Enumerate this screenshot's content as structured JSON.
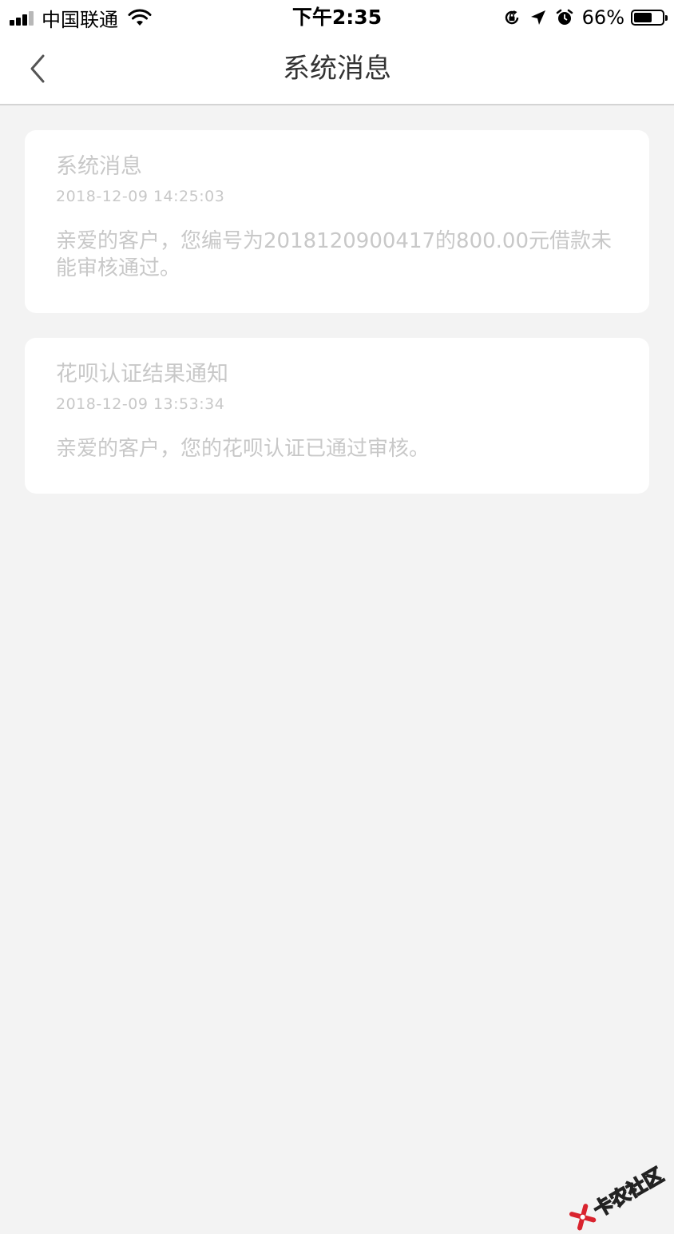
{
  "status_bar": {
    "carrier": "中国联通",
    "time": "下午2:35",
    "battery_percent": "66%",
    "battery_level": 0.66,
    "signal_bars": 3,
    "icons": [
      "signal-icon",
      "wifi-icon",
      "orientation-lock-icon",
      "location-arrow-icon",
      "alarm-icon",
      "battery-icon"
    ]
  },
  "nav": {
    "title": "系统消息",
    "back_icon": "chevron-left-icon"
  },
  "messages": [
    {
      "title": "系统消息",
      "time": "2018-12-09 14:25:03",
      "body": "亲爱的客户，您编号为2018120900417的800.00元借款未能审核通过。"
    },
    {
      "title": "花呗认证结果通知",
      "time": "2018-12-09 13:53:34",
      "body": "亲爱的客户，您的花呗认证已通过审核。"
    }
  ],
  "watermark": {
    "text": "卡农社区"
  },
  "colors": {
    "background": "#f3f3f3",
    "card": "#ffffff",
    "muted_text": "#c8c8c8",
    "title_text": "#333333",
    "watermark_red": "#d9232e"
  }
}
